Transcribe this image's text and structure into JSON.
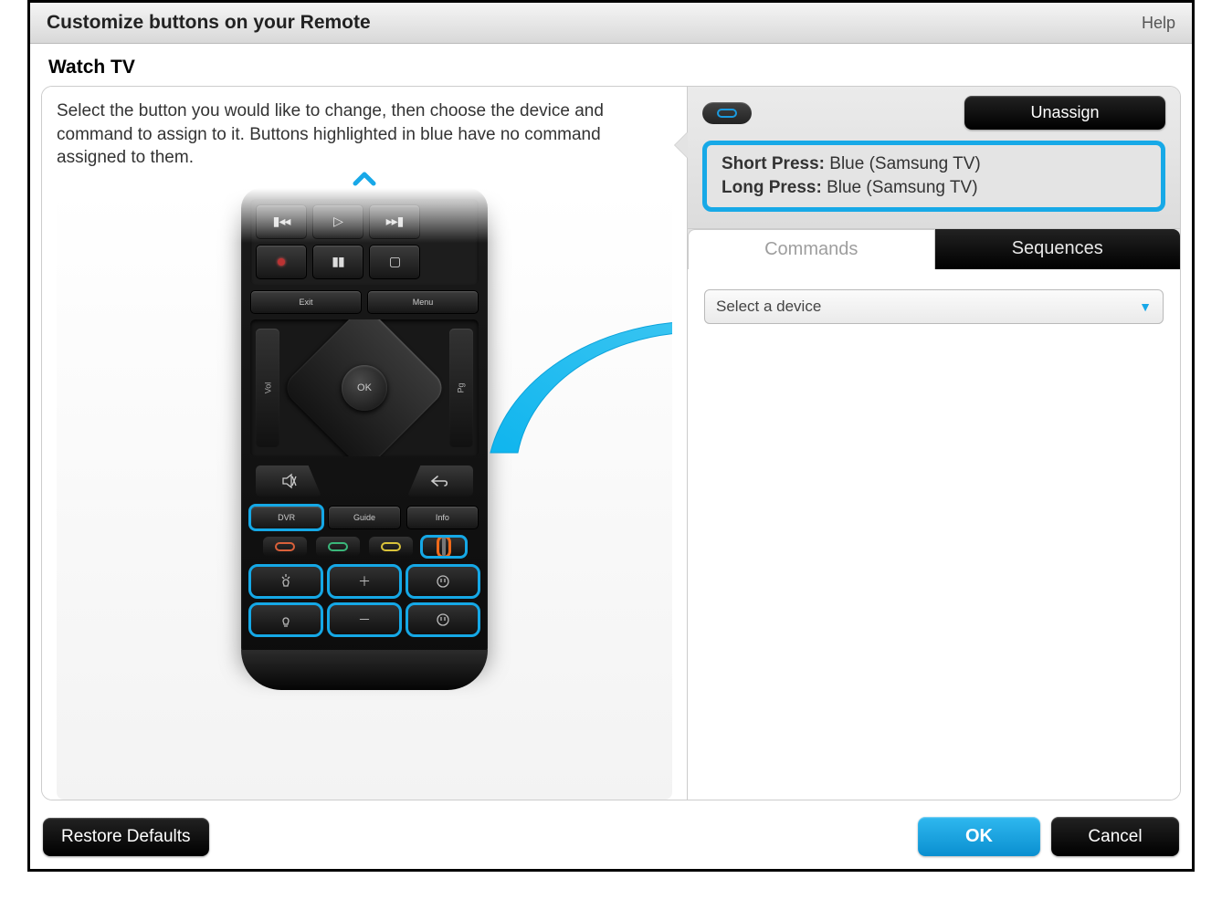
{
  "title": "Customize buttons on your Remote",
  "help": "Help",
  "subtitle": "Watch TV",
  "instructions": "Select the button you would like to change, then choose the device and command to assign to it. Buttons highlighted in blue have no command assigned to them.",
  "remote": {
    "exit": "Exit",
    "menu": "Menu",
    "ok": "OK",
    "vol": "Vol",
    "pg": "Pg",
    "dvr": "DVR",
    "guide": "Guide",
    "info": "Info"
  },
  "rightPanel": {
    "unassign": "Unassign",
    "shortPressLabel": "Short Press:",
    "shortPressValue": "Blue (Samsung TV)",
    "longPressLabel": "Long Press:",
    "longPressValue": "Blue (Samsung TV)",
    "tabCommands": "Commands",
    "tabSequences": "Sequences",
    "selectDevice": "Select a device"
  },
  "footer": {
    "restore": "Restore Defaults",
    "ok": "OK",
    "cancel": "Cancel"
  }
}
